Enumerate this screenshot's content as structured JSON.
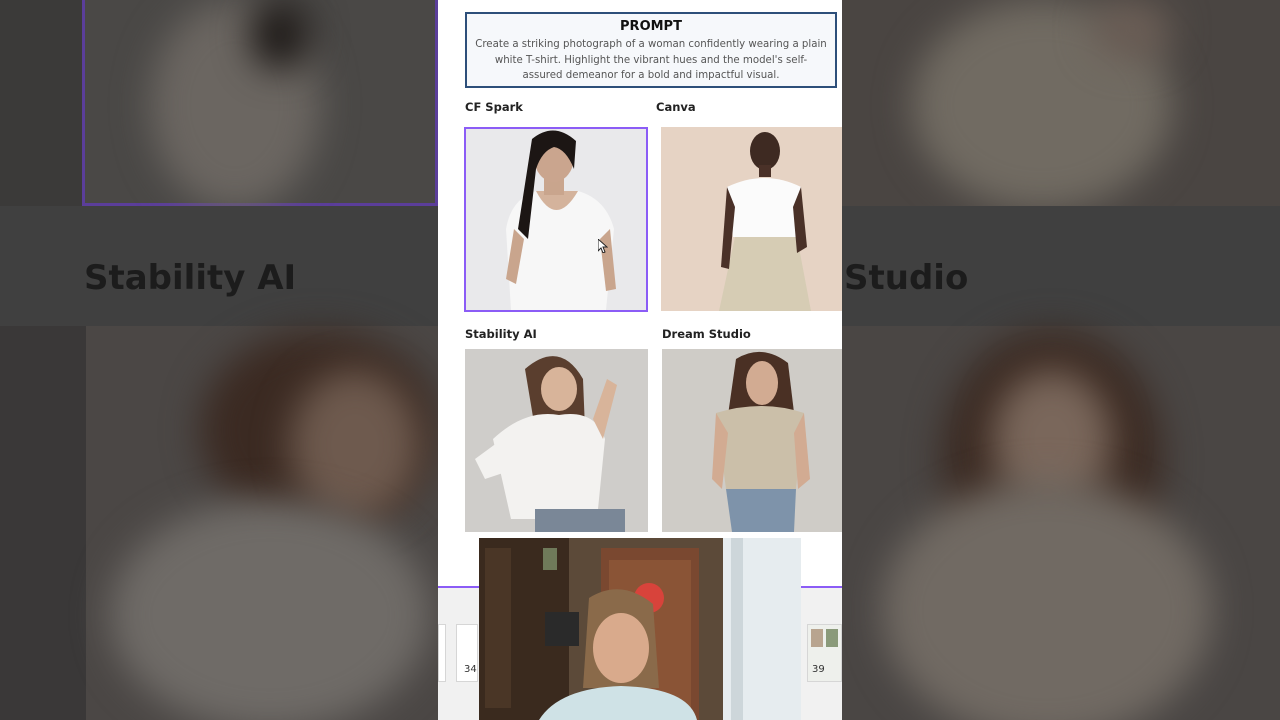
{
  "prompt": {
    "title": "PROMPT",
    "line1": "Create a striking photograph of a woman confidently wearing a plain",
    "line2": "white T-shirt. Highlight the vibrant hues and the model's self-",
    "line3": "assured demeanor for a bold and impactful visual."
  },
  "tools": [
    {
      "label": "CF Spark"
    },
    {
      "label": "Canva"
    },
    {
      "label": "Stability AI"
    },
    {
      "label": "Dream Studio"
    }
  ],
  "background": {
    "left_label": "Stability AI",
    "right_label": "Studio"
  },
  "slides": {
    "left_page": "34",
    "right_page": "39"
  },
  "colors": {
    "accent": "#8b5cf6",
    "prompt_border": "#2d4f7a"
  }
}
